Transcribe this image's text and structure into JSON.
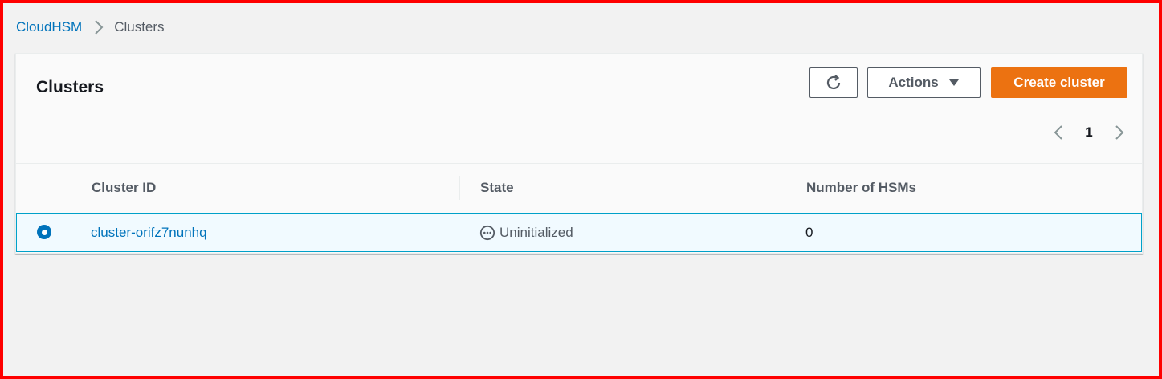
{
  "breadcrumb": {
    "service": "CloudHSM",
    "current": "Clusters"
  },
  "panel": {
    "title": "Clusters",
    "refresh_icon": "refresh-icon",
    "actions_label": "Actions",
    "create_label": "Create cluster"
  },
  "pagination": {
    "current_page": "1"
  },
  "table": {
    "columns": [
      "Cluster ID",
      "State",
      "Number of HSMs"
    ],
    "rows": [
      {
        "selected": true,
        "cluster_id": "cluster-orifz7nunhq",
        "state": "Uninitialized",
        "state_icon": "pending-status-icon",
        "hsm_count": "0"
      }
    ]
  },
  "colors": {
    "link": "#0073bb",
    "primary_button": "#ec7211",
    "selected_row_bg": "#f1faff",
    "selected_row_border": "#00a1c9",
    "frame": "#ff0000"
  }
}
